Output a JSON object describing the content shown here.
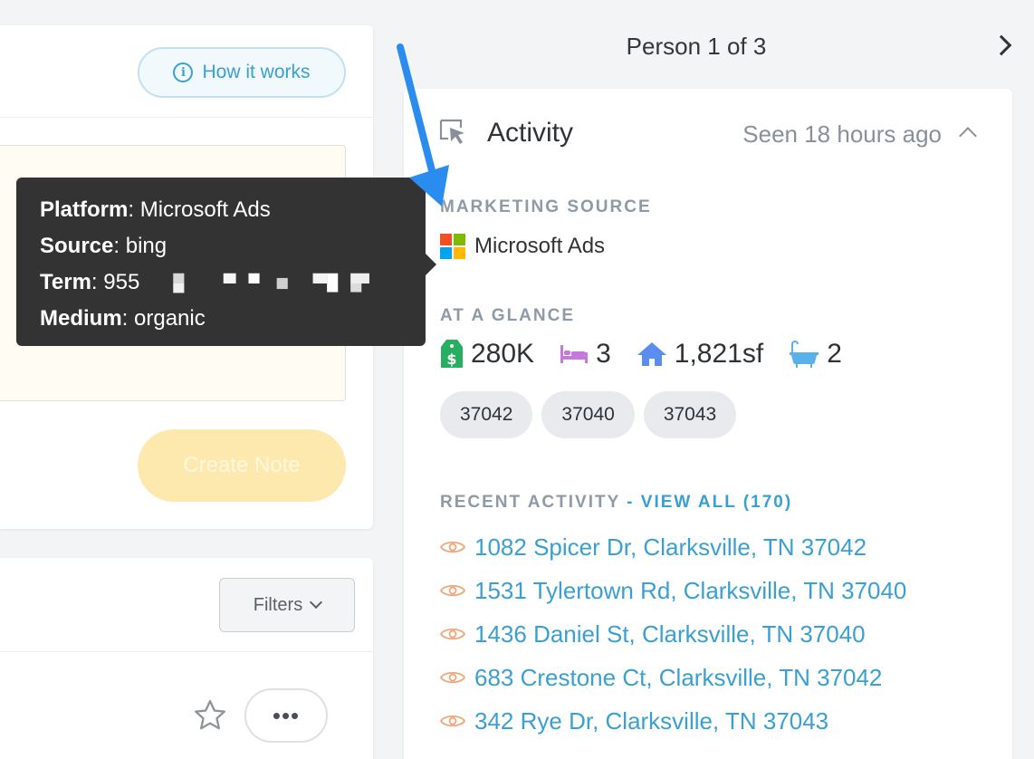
{
  "left_panel": {
    "how_it_works_label": "How it works",
    "create_note_label": "Create Note",
    "filters_label": "Filters",
    "more_label": "•••"
  },
  "tooltip": {
    "platform_key": "Platform",
    "platform_value": "Microsoft Ads",
    "source_key": "Source",
    "source_value": "bing",
    "term_key": "Term",
    "term_value": "955",
    "medium_key": "Medium",
    "medium_value": "organic"
  },
  "person_nav": {
    "label": "Person 1 of 3"
  },
  "activity": {
    "title": "Activity",
    "seen": "Seen 18 hours ago",
    "marketing_source_label": "MARKETING SOURCE",
    "marketing_source_value": "Microsoft Ads",
    "glance_label": "AT A GLANCE",
    "glance": {
      "price": "280K",
      "beds": "3",
      "sqft": "1,821sf",
      "baths": "2"
    },
    "zips": [
      "37042",
      "37040",
      "37043"
    ],
    "recent_label": "RECENT ACTIVITY",
    "recent_separator": " - ",
    "view_all_label": "VIEW ALL (170)",
    "recent_items": [
      "1082 Spicer Dr, Clarksville, TN 37042",
      "1531 Tylertown Rd, Clarksville, TN 37040",
      "1436 Daniel St, Clarksville, TN 37040",
      "683 Crestone Ct, Clarksville, TN 37042",
      "342 Rye Dr, Clarksville, TN 37043"
    ]
  },
  "colors": {
    "accent_blue": "#3a9fd4",
    "tooltip_bg": "#333333",
    "create_note_bg": "#fde9ad",
    "arrow": "#2b8cf0"
  }
}
